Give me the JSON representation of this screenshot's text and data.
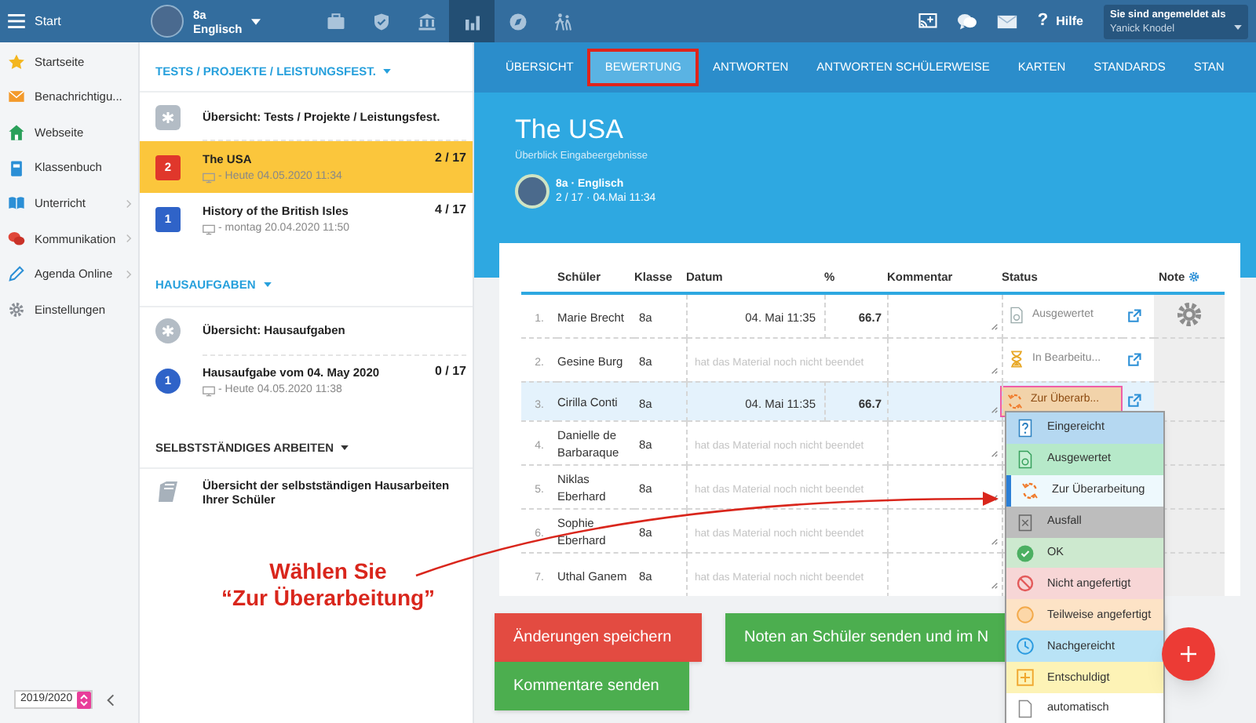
{
  "topbar": {
    "menu_label": "Start",
    "class_name": "8a",
    "subject": "Englisch",
    "nav_icons": [
      {
        "kind": "briefcase",
        "selected": false
      },
      {
        "kind": "shield",
        "selected": false
      },
      {
        "kind": "bank",
        "selected": false
      },
      {
        "kind": "chart",
        "selected": true
      },
      {
        "kind": "compass",
        "selected": false
      },
      {
        "kind": "walkers",
        "selected": false
      }
    ],
    "help_icon": "?",
    "help": "Hilfe",
    "user_caption": "Sie sind angemeldet als",
    "user_name": "Yanick Knodel"
  },
  "sidebar": {
    "items": [
      {
        "kind": "star",
        "label": "Startseite",
        "has_submenu": false
      },
      {
        "kind": "mail",
        "label": "Benachrichtigu...",
        "has_submenu": false
      },
      {
        "kind": "house",
        "label": "Webseite",
        "has_submenu": false
      },
      {
        "kind": "book",
        "label": "Klassenbuch",
        "has_submenu": false
      },
      {
        "kind": "openbook",
        "label": "Unterricht",
        "has_submenu": true
      },
      {
        "kind": "chat",
        "label": "Kommunikation",
        "has_submenu": true
      },
      {
        "kind": "pen",
        "label": "Agenda Online",
        "has_submenu": true
      },
      {
        "kind": "gear",
        "label": "Einstellungen",
        "has_submenu": false
      }
    ],
    "year": "2019/2020"
  },
  "sections": [
    {
      "title": "TESTS / PROJEKTE / LEISTUNGSFEST.",
      "items": [
        {
          "kind": "overview_square",
          "title": "Übersicht: Tests / Projekte / Leistungsfest.",
          "selected": false
        },
        {
          "kind": "square",
          "badge": "2",
          "color": "#e0372b",
          "title": "The USA",
          "meta": "- Heute 04.05.2020 11:34",
          "count": "2 / 17",
          "selected": true
        },
        {
          "kind": "square",
          "badge": "1",
          "color": "#2f63c8",
          "title": "History of the British Isles",
          "meta": "- montag 20.04.2020 11:50",
          "count": "4 / 17",
          "selected": false
        }
      ]
    },
    {
      "title": "HAUSAUFGABEN",
      "items": [
        {
          "kind": "overview_circle",
          "title": "Übersicht: Hausaufgaben",
          "selected": false
        },
        {
          "kind": "circle",
          "badge": "1",
          "color": "#2f63c8",
          "title": "Hausaufgabe vom 04. May 2020",
          "meta": "- Heute 04.05.2020 11:38",
          "count": "0 / 17",
          "selected": false
        }
      ]
    },
    {
      "title": "SELBSTSTÄNDIGES ARBEITEN",
      "items": [
        {
          "kind": "book",
          "title": "Übersicht der selbstständigen Hausarbeiten Ihrer Schüler",
          "selected": false
        }
      ]
    }
  ],
  "annotation": {
    "lines": [
      "Wählen Sie",
      "“Zur Überarbeitung”"
    ]
  },
  "tabs": [
    {
      "label": "ÜBERSICHT",
      "selected": false,
      "annotated": false
    },
    {
      "label": "BEWERTUNG",
      "selected": true,
      "annotated": true
    },
    {
      "label": "ANTWORTEN",
      "selected": false,
      "annotated": false
    },
    {
      "label": "ANTWORTEN SCHÜLERWEISE",
      "selected": false,
      "annotated": false
    },
    {
      "label": "KARTEN",
      "selected": false,
      "annotated": false
    },
    {
      "label": "STANDARDS",
      "selected": false,
      "annotated": false
    },
    {
      "label": "STAN",
      "selected": false,
      "annotated": false
    }
  ],
  "header": {
    "title": "The USA",
    "subtitle": "Überblick Eingabeergebnisse",
    "class_line": "8a · Englisch",
    "info_line": "2 / 17 · 04.Mai 11:34"
  },
  "table": {
    "columns": [
      "Schüler",
      "Klasse",
      "Datum",
      "%",
      "Kommentar",
      "Status",
      "Note"
    ],
    "rows": [
      {
        "num": "1.",
        "name": "Marie Brecht",
        "class": "8a",
        "date": "04. Mai 11:35",
        "percent": "66.7",
        "status": {
          "kind": "evaluated",
          "label": "Ausgewertet"
        },
        "selected": false
      },
      {
        "num": "2.",
        "name": "Gesine Burg",
        "class": "8a",
        "note": "hat das Material noch nicht beendet",
        "status": {
          "kind": "in_progress",
          "label": "In Bearbeitu..."
        },
        "selected": false
      },
      {
        "num": "3.",
        "name": "Cirilla Conti",
        "class": "8a",
        "date": "04. Mai 11:35",
        "percent": "66.7",
        "status": {
          "kind": "revision",
          "label": "Zur Überarb..."
        },
        "selected": true
      },
      {
        "num": "4.",
        "name": "Danielle de Barbaraque",
        "class": "8a",
        "note": "hat das Material noch nicht beendet",
        "selected": false
      },
      {
        "num": "5.",
        "name": "Niklas Eberhard",
        "class": "8a",
        "note": "hat das Material noch nicht beendet",
        "selected": false
      },
      {
        "num": "6.",
        "name": "Sophie Eberhard",
        "class": "8a",
        "note": "hat das Material noch nicht beendet",
        "selected": false
      },
      {
        "num": "7.",
        "name": "Uthal Ganem",
        "class": "8a",
        "note": "hat das Material noch nicht beendet",
        "selected": false
      }
    ]
  },
  "status_menu": [
    {
      "kind": "submitted",
      "label": "Eingereicht",
      "color": "#b5d8f1",
      "selected": false
    },
    {
      "kind": "evaluated",
      "label": "Ausgewertet",
      "color": "#b6e9c9",
      "selected": false
    },
    {
      "kind": "revision",
      "label": "Zur Überarbeitung",
      "color": "#eef9fd",
      "selected": true
    },
    {
      "kind": "failed",
      "label": "Ausfall",
      "color": "#bdbdbd",
      "selected": false
    },
    {
      "kind": "ok",
      "label": "OK",
      "color": "#cde9cf",
      "selected": false
    },
    {
      "kind": "not_done",
      "label": "Nicht angefertigt",
      "color": "#f7d6d6",
      "selected": false
    },
    {
      "kind": "partial",
      "label": "Teilweise angefertigt",
      "color": "#fde3c6",
      "selected": false
    },
    {
      "kind": "late",
      "label": "Nachgereicht",
      "color": "#b9e3f6",
      "selected": false
    },
    {
      "kind": "excused",
      "label": "Entschuldigt",
      "color": "#fdf3b6",
      "selected": false
    },
    {
      "kind": "auto",
      "label": "automatisch",
      "color": "#ffffff",
      "selected": false
    }
  ],
  "buttons": [
    {
      "kind": "danger",
      "label": "Änderungen speichern"
    },
    {
      "kind": "success",
      "label": "Noten an Schüler senden und im N"
    },
    {
      "kind": "success",
      "label": "Kommentare senden"
    }
  ]
}
